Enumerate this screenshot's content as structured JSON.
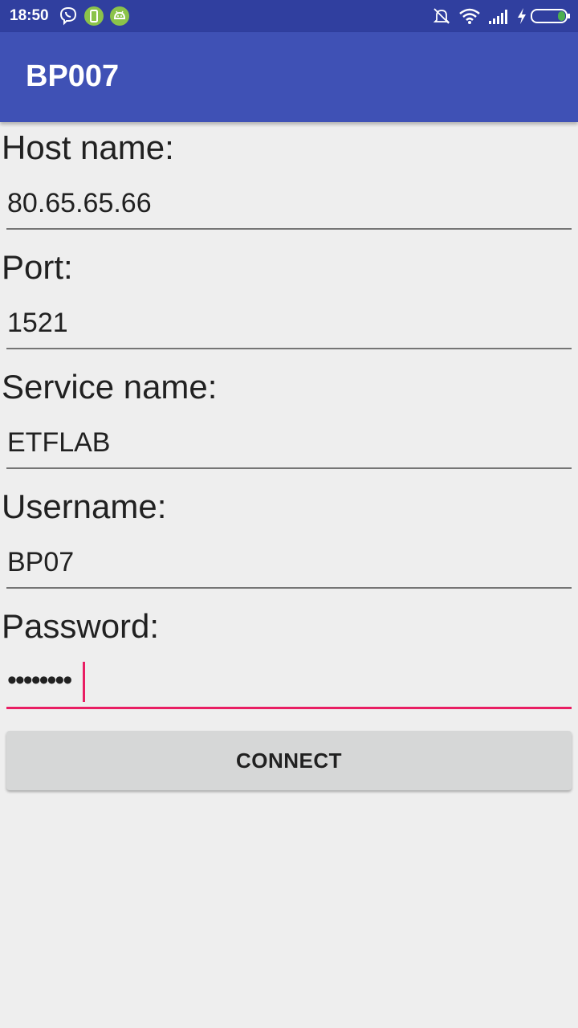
{
  "status_bar": {
    "time": "18:50",
    "icons": [
      "viber-icon",
      "phone-app-icon",
      "android-icon",
      "notifications-off-icon",
      "wifi-icon",
      "signal-icon",
      "charging-bolt-icon",
      "battery-icon"
    ]
  },
  "app_bar": {
    "title": "BP007"
  },
  "form": {
    "host": {
      "label": "Host name:",
      "value": "80.65.65.66"
    },
    "port": {
      "label": "Port:",
      "value": "1521"
    },
    "service": {
      "label": "Service name:",
      "value": "ETFLAB"
    },
    "username": {
      "label": "Username:",
      "value": "BP07"
    },
    "password": {
      "label": "Password:",
      "value": "••••••••"
    }
  },
  "connect_button": {
    "label": "CONNECT"
  },
  "colors": {
    "primary": "#3f51b5",
    "primary_dark": "#303f9f",
    "accent": "#e91e63",
    "background": "#eeeeee"
  }
}
